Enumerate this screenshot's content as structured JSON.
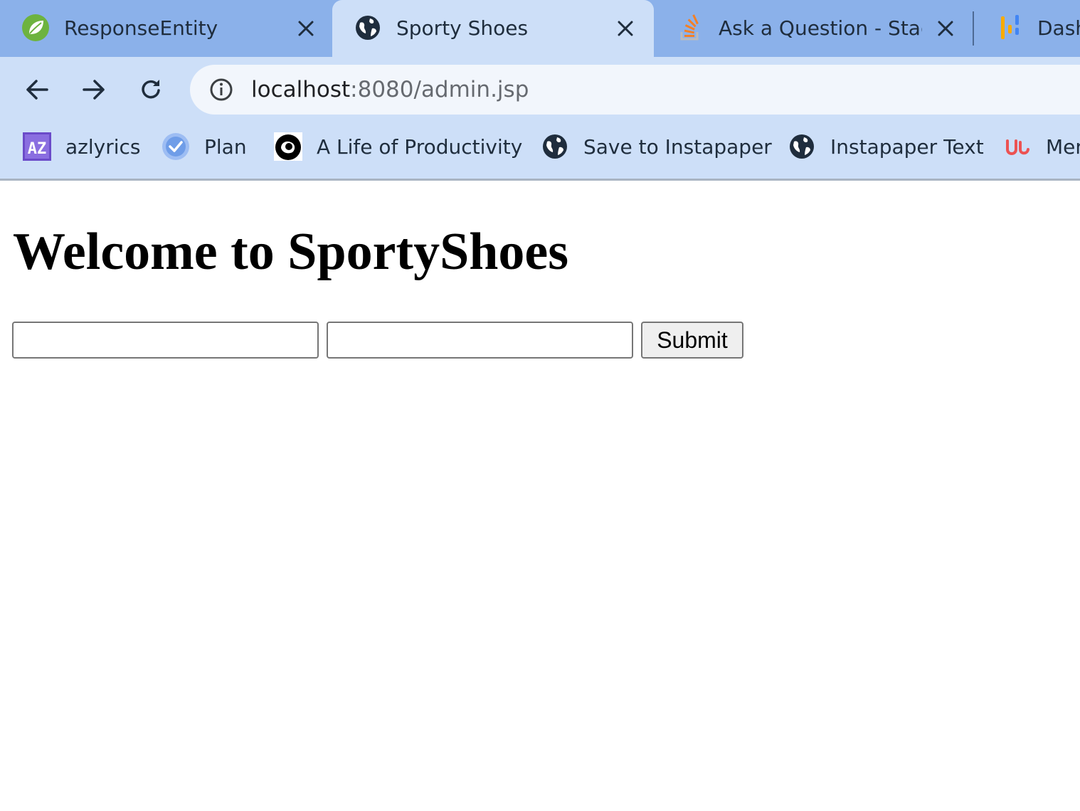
{
  "browser": {
    "tabs": [
      {
        "title": "ResponseEntity",
        "favicon": "spring-leaf-icon",
        "active": false
      },
      {
        "title": "Sporty Shoes",
        "favicon": "globe-icon",
        "active": true
      },
      {
        "title": "Ask a Question - Stack Overflow",
        "favicon": "stackoverflow-icon",
        "active": false
      },
      {
        "title": "Dash",
        "favicon": "dashboard-icon",
        "active": false
      }
    ],
    "address_bar": {
      "host": "localhost",
      "path": ":8080/admin.jsp",
      "security_icon": "info-icon"
    },
    "bookmarks": [
      {
        "label": "azlyrics",
        "icon": "azlyrics-icon"
      },
      {
        "label": "Plan",
        "icon": "check-circle-icon"
      },
      {
        "label": "A Life of Productivity",
        "icon": "productivity-icon"
      },
      {
        "label": "Save to Instapaper",
        "icon": "globe-icon"
      },
      {
        "label": "Instapaper Text",
        "icon": "globe-icon"
      },
      {
        "label": "Men",
        "icon": "udemy-icon"
      }
    ],
    "colors": {
      "tabstrip": "#8bb1ea",
      "toolbar": "#cddff8",
      "omnibox": "#f2f6fc"
    }
  },
  "page": {
    "heading": "Welcome to SportyShoes",
    "form": {
      "field1_value": "",
      "field2_value": "",
      "submit_label": "Submit"
    }
  }
}
